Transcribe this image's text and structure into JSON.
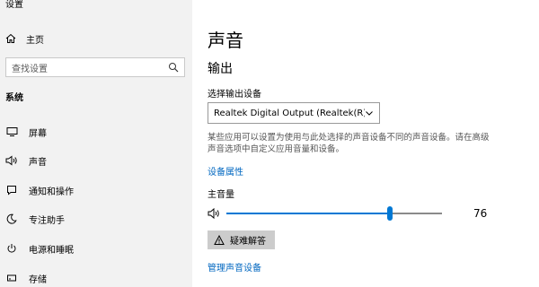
{
  "app": {
    "title": "设置"
  },
  "sidebar": {
    "home_label": "主页",
    "search_placeholder": "查找设置",
    "section_label": "系统",
    "items": [
      {
        "label": "屏幕",
        "icon": "monitor-icon"
      },
      {
        "label": "声音",
        "icon": "speaker-icon"
      },
      {
        "label": "通知和操作",
        "icon": "notification-icon"
      },
      {
        "label": "专注助手",
        "icon": "moon-icon"
      },
      {
        "label": "电源和睡眠",
        "icon": "power-icon"
      },
      {
        "label": "存储",
        "icon": "storage-icon"
      }
    ]
  },
  "main": {
    "page_title": "声音",
    "output_section": "输出",
    "device_label": "选择输出设备",
    "device_value": "Realtek Digital Output (Realtek(R) A...",
    "description": "某些应用可以设置为使用与此处选择的声音设备不同的声音设备。请在高级声音选项中自定义应用音量和设备。",
    "device_properties_link": "设备属性",
    "master_volume_label": "主音量",
    "volume_value": "76",
    "volume_level": 0.76,
    "troubleshoot_label": "疑难解答",
    "manage_devices_link": "管理声音设备"
  },
  "colors": {
    "accent": "#0078d4",
    "link": "#0067c0",
    "sidebar_bg": "#f2f2f2"
  }
}
